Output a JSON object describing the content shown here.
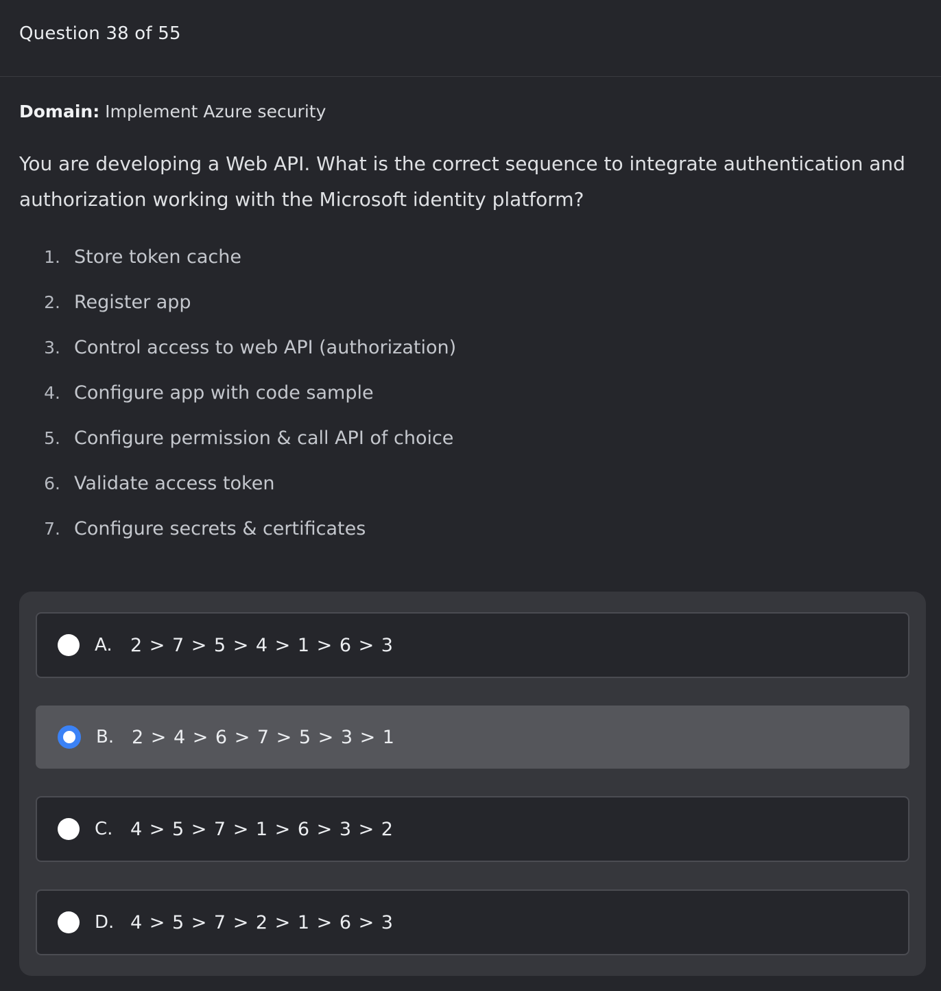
{
  "header": {
    "title": "Question 38 of 55"
  },
  "domain": {
    "label": "Domain:",
    "value": "Implement Azure security"
  },
  "question": {
    "text": "You are developing a Web API. What is the correct sequence to integrate authentication and authorization working with the Microsoft identity platform?"
  },
  "steps": [
    {
      "num": "1.",
      "text": "Store token cache"
    },
    {
      "num": "2.",
      "text": "Register app"
    },
    {
      "num": "3.",
      "text": "Control access to web API (authorization)"
    },
    {
      "num": "4.",
      "text": "Configure app with code sample"
    },
    {
      "num": "5.",
      "text": "Configure permission & call API of choice"
    },
    {
      "num": "6.",
      "text": "Validate access token"
    },
    {
      "num": "7.",
      "text": "Configure secrets & certificates"
    }
  ],
  "options": [
    {
      "letter": "A.",
      "sequence": "2 > 7 > 5 > 4 > 1 > 6 > 3",
      "selected": false
    },
    {
      "letter": "B.",
      "sequence": "2 > 4 > 6 > 7 > 5 > 3 > 1",
      "selected": true
    },
    {
      "letter": "C.",
      "sequence": "4 > 5 > 7 > 1 > 6 > 3 > 2",
      "selected": false
    },
    {
      "letter": "D.",
      "sequence": "4 > 5 > 7 > 2 > 1 > 6 > 3",
      "selected": false
    }
  ],
  "colors": {
    "background": "#25262b",
    "panel": "#36373c",
    "selected_option": "#55565b",
    "radio_checked": "#3b82f6"
  }
}
